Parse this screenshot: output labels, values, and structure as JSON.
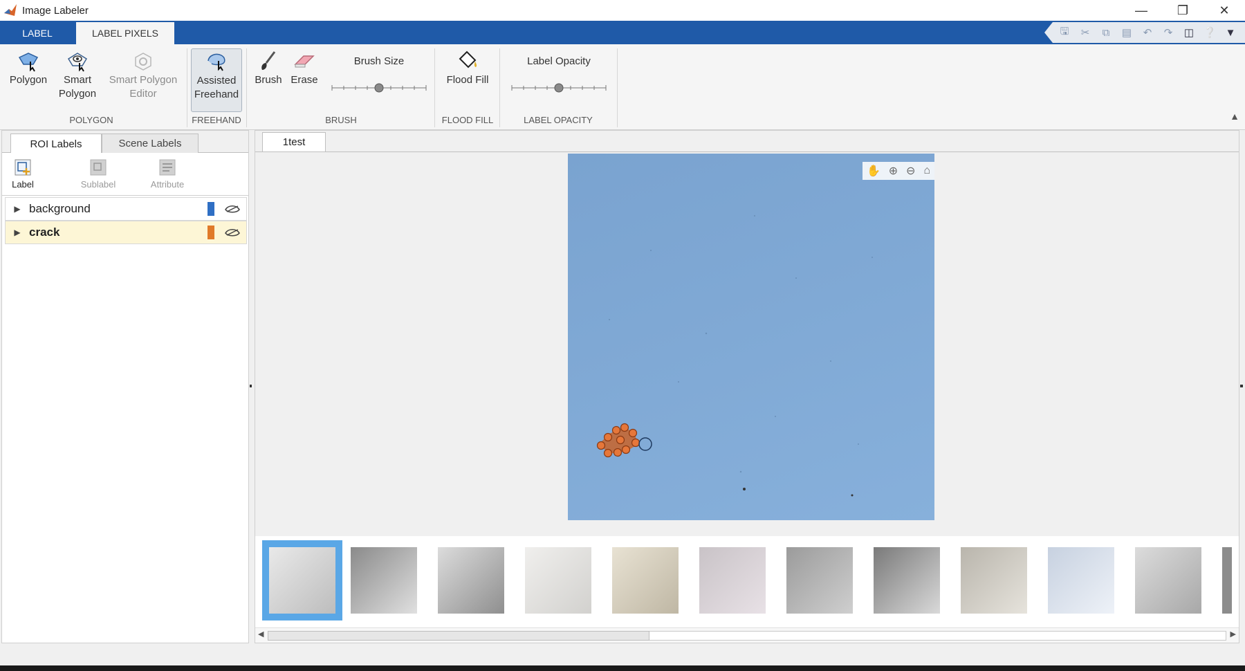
{
  "window": {
    "title": "Image Labeler",
    "controls": [
      "minimize-icon",
      "restore-icon",
      "close-icon"
    ]
  },
  "ribbon_tabs": [
    {
      "label": "LABEL"
    },
    {
      "label": "LABEL PIXELS",
      "active": true
    }
  ],
  "quick_access": [
    "save-icon",
    "cut-icon",
    "copy-icon",
    "paste-icon",
    "undo-icon",
    "redo-icon",
    "window-icon",
    "help-icon",
    "expand-icon"
  ],
  "toolbar": {
    "polygon": {
      "label1": "Polygon",
      "label2": ""
    },
    "smart_polygon": {
      "label1": "Smart",
      "label2": "Polygon"
    },
    "smart_polygon_editor": {
      "label1": "Smart Polygon",
      "label2": "Editor"
    },
    "assisted_freehand": {
      "label1": "Assisted",
      "label2": "Freehand"
    },
    "brush": {
      "label": "Brush"
    },
    "erase": {
      "label": "Erase"
    },
    "brush_size": {
      "label": "Brush Size",
      "level": 0.5
    },
    "flood_fill": {
      "label": "Flood Fill"
    },
    "label_opacity": {
      "label": "Label Opacity",
      "level": 0.5
    }
  },
  "groups": {
    "polygon": "POLYGON",
    "freehand": "FREEHAND",
    "brush": "BRUSH",
    "flood_fill": "FLOOD FILL",
    "label_opacity": "LABEL OPACITY"
  },
  "left_panel": {
    "tabs": [
      {
        "label": "ROI Labels",
        "active": true
      },
      {
        "label": "Scene Labels"
      }
    ],
    "tools": [
      {
        "label": "Label"
      },
      {
        "label": "Sublabel",
        "disabled": true
      },
      {
        "label": "Attribute",
        "disabled": true
      }
    ],
    "labels": [
      {
        "name": "background",
        "color": "#2f6fc4"
      },
      {
        "name": "crack",
        "color": "#e07a2a",
        "selected": true
      }
    ]
  },
  "document": {
    "tab": "1test",
    "thumbnail_count": 11,
    "selected_thumbnail": 1
  },
  "colors": {
    "accent": "#1f5aa8",
    "selected_row": "#fdf6d6",
    "crack": "#e07a2a",
    "background_label": "#2f6fc4"
  }
}
